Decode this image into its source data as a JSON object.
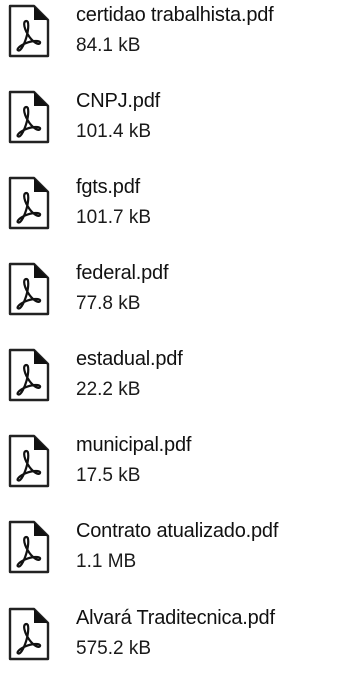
{
  "files": [
    {
      "name": "certidao trabalhista.pdf",
      "size": "84.1 kB",
      "icon": "pdf-file-icon"
    },
    {
      "name": "CNPJ.pdf",
      "size": "101.4 kB",
      "icon": "pdf-file-icon"
    },
    {
      "name": "fgts.pdf",
      "size": "101.7 kB",
      "icon": "pdf-file-icon"
    },
    {
      "name": "federal.pdf",
      "size": "77.8 kB",
      "icon": "pdf-file-icon"
    },
    {
      "name": "estadual.pdf",
      "size": "22.2 kB",
      "icon": "pdf-file-icon"
    },
    {
      "name": "municipal.pdf",
      "size": "17.5 kB",
      "icon": "pdf-file-icon"
    },
    {
      "name": "Contrato atualizado.pdf",
      "size": "1.1 MB",
      "icon": "pdf-file-icon"
    },
    {
      "name": "Alvará Traditecnica.pdf",
      "size": "575.2 kB",
      "icon": "pdf-file-icon"
    }
  ]
}
